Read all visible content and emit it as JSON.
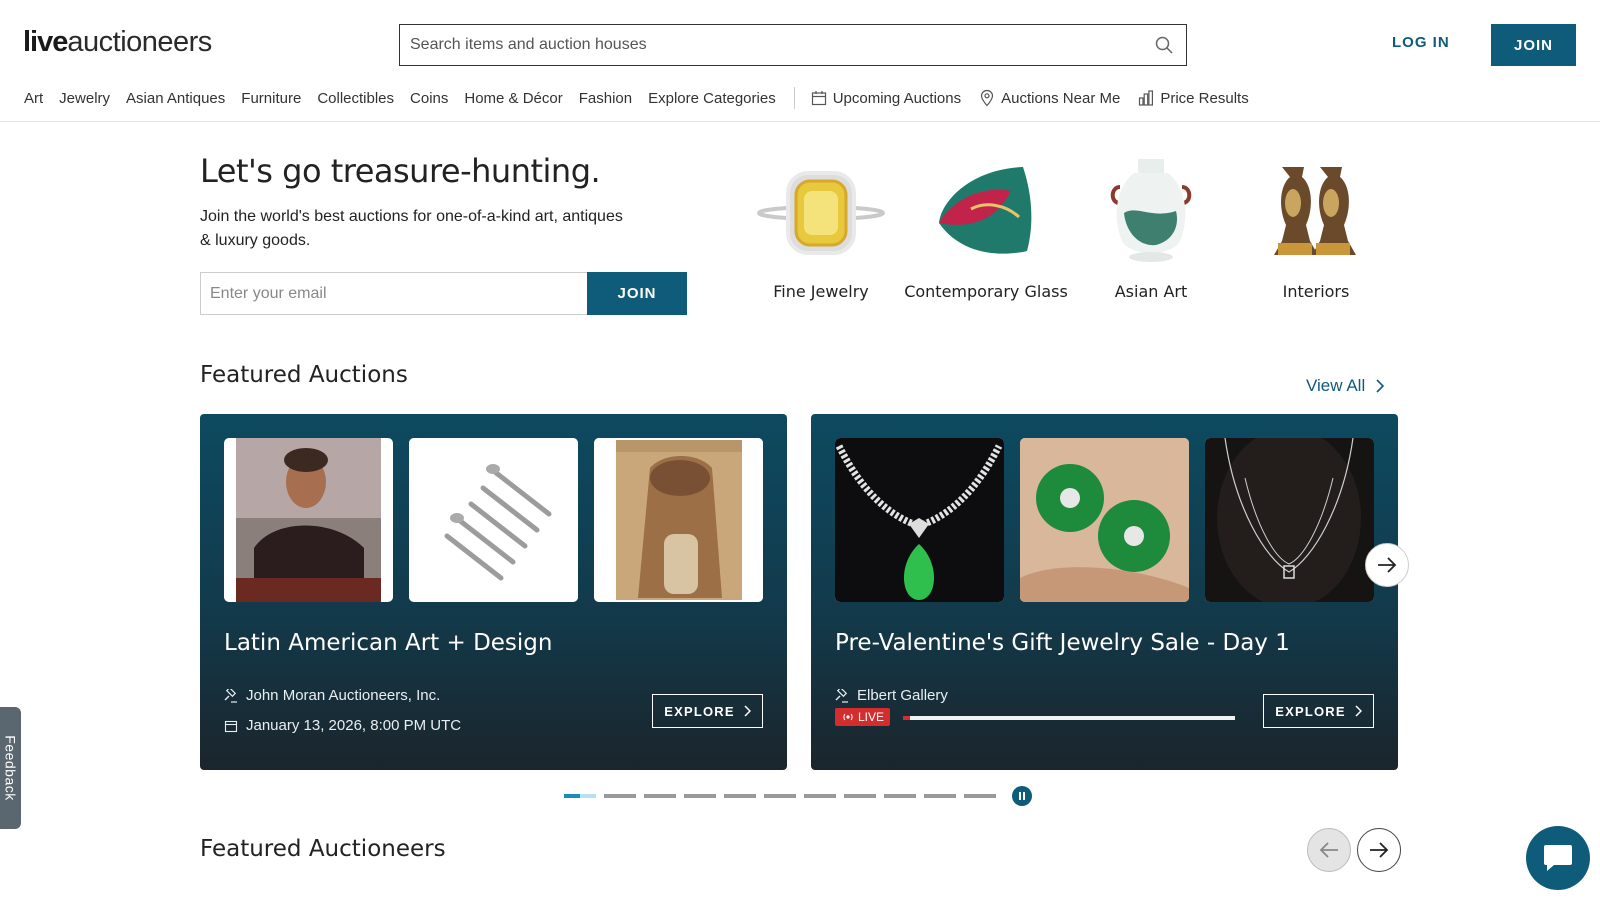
{
  "header": {
    "logo_bold": "live",
    "logo_light": "auctioneers",
    "search_placeholder": "Search items and auction houses",
    "login_label": "LOG IN",
    "join_label": "JOIN"
  },
  "nav": {
    "categories": [
      "Art",
      "Jewelry",
      "Asian Antiques",
      "Furniture",
      "Collectibles",
      "Coins",
      "Home & Décor",
      "Fashion",
      "Explore Categories"
    ],
    "utilities": [
      {
        "label": "Upcoming Auctions",
        "icon": "calendar-icon"
      },
      {
        "label": "Auctions Near Me",
        "icon": "location-pin-icon"
      },
      {
        "label": "Price Results",
        "icon": "bar-chart-icon"
      }
    ]
  },
  "hero": {
    "title": "Let's go treasure-hunting.",
    "subtitle": "Join the world's best auctions for one-of-a-kind art, antiques & luxury goods.",
    "email_placeholder": "Enter your email",
    "join_label": "JOIN",
    "categories": [
      "Fine Jewelry",
      "Contemporary Glass",
      "Asian Art",
      "Interiors"
    ]
  },
  "featured_auctions": {
    "title": "Featured Auctions",
    "view_all": "View All",
    "cards": [
      {
        "title": "Latin American Art + Design",
        "house": "John Moran Auctioneers, Inc.",
        "date": "January 13, 2026, 8:00 PM UTC",
        "explore": "EXPLORE"
      },
      {
        "title": "Pre-Valentine's Gift Jewelry Sale - Day 1",
        "house": "Elbert Gallery",
        "live": "LIVE",
        "progress": 0.02,
        "explore": "EXPLORE"
      }
    ],
    "carousel_pages": 11,
    "carousel_active": 1
  },
  "featured_auctioneers": {
    "title": "Featured Auctioneers"
  },
  "feedback_label": "Feedback",
  "colors": {
    "brand": "#0e5b7a",
    "live_red": "#d32d2d"
  }
}
